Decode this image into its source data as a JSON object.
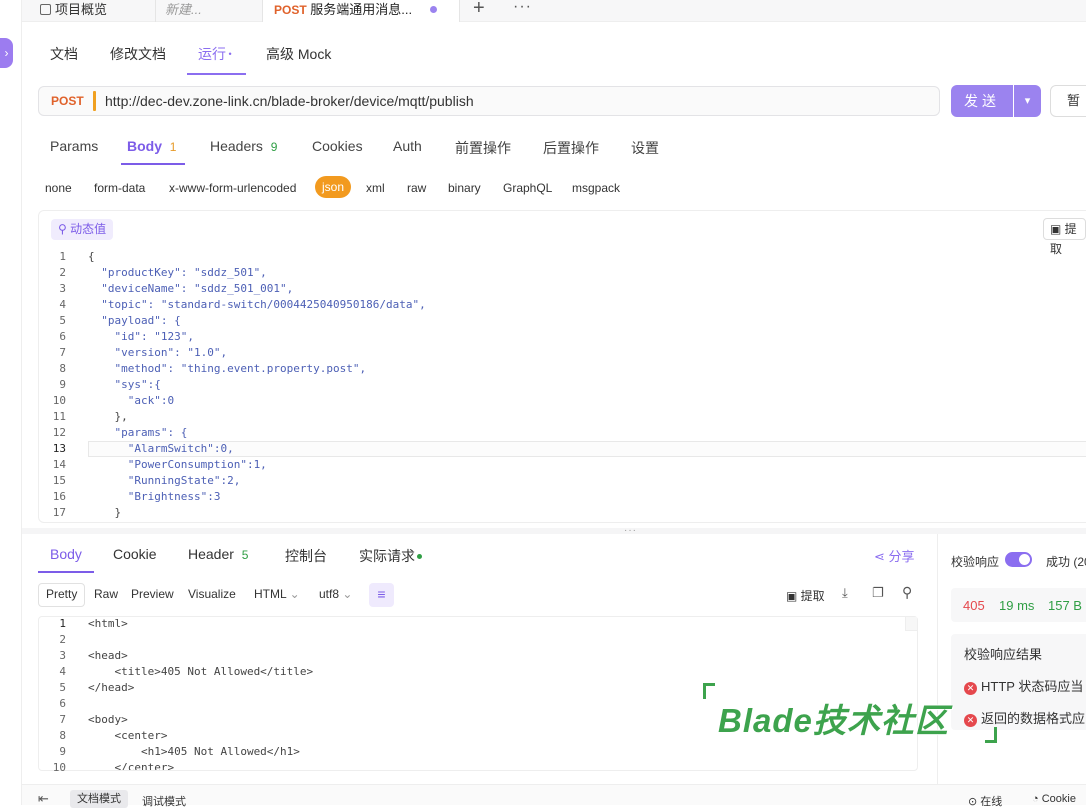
{
  "tabs": [
    {
      "label": "项目概览"
    },
    {
      "label": "新建..."
    },
    {
      "method": "POST",
      "label": "服务端通用消息..."
    }
  ],
  "subnav": {
    "doc": "文档",
    "edit": "修改文档",
    "run": "运行",
    "mock": "高级 Mock"
  },
  "request": {
    "method": "POST",
    "url": "http://dec-dev.zone-link.cn/blade-broker/device/mqtt/publish",
    "send_label": "发送",
    "save_label": "暂"
  },
  "req_tabs": {
    "params": "Params",
    "body": "Body",
    "body_count": "1",
    "headers": "Headers",
    "headers_count": "9",
    "cookies": "Cookies",
    "auth": "Auth",
    "pre": "前置操作",
    "post": "后置操作",
    "settings": "设置"
  },
  "body_types": [
    "none",
    "form-data",
    "x-www-form-urlencoded",
    "json",
    "xml",
    "raw",
    "binary",
    "GraphQL",
    "msgpack"
  ],
  "editor": {
    "dynamic_label": "动态值",
    "extract_label": "提取",
    "line_numbers": [
      "1",
      "2",
      "3",
      "4",
      "5",
      "6",
      "7",
      "8",
      "9",
      "10",
      "11",
      "12",
      "13",
      "14",
      "15",
      "16",
      "17"
    ],
    "lines": [
      "{",
      "  \"productKey\": \"sddz_501\",",
      "  \"deviceName\": \"sddz_501_001\",",
      "  \"topic\": \"standard-switch/0004425040950186/data\",",
      "  \"payload\": {",
      "    \"id\": \"123\",",
      "    \"version\": \"1.0\",",
      "    \"method\": \"thing.event.property.post\",",
      "    \"sys\":{",
      "      \"ack\":0",
      "    },",
      "    \"params\": {",
      "      \"AlarmSwitch\":0,",
      "      \"PowerConsumption\":1,",
      "      \"RunningState\":2,",
      "      \"Brightness\":3",
      "    }"
    ]
  },
  "response_tabs": {
    "body": "Body",
    "cookie": "Cookie",
    "header": "Header",
    "header_count": "5",
    "console": "控制台",
    "actual": "实际请求",
    "share": "分享"
  },
  "view_tabs": {
    "pretty": "Pretty",
    "raw": "Raw",
    "preview": "Preview",
    "visualize": "Visualize",
    "format": "HTML",
    "encoding": "utf8",
    "extract": "提取"
  },
  "response": {
    "line_numbers": [
      "1",
      "2",
      "3",
      "4",
      "5",
      "6",
      "7",
      "8",
      "9",
      "10"
    ],
    "lines": [
      "<html>",
      "",
      "<head>",
      "    <title>405 Not Allowed</title>",
      "</head>",
      "",
      "<body>",
      "    <center>",
      "        <h1>405 Not Allowed</h1>",
      "    </center>"
    ]
  },
  "status": {
    "validate_label": "校验响应",
    "success_label": "成功 (20",
    "code": "405",
    "time": "19 ms",
    "size": "157 B"
  },
  "validation": {
    "title": "校验响应结果",
    "item1": "HTTP 状态码应当",
    "item2": "返回的数据格式应"
  },
  "watermark": "Blade技术社区",
  "footer": {
    "doc_mode": "文档模式",
    "debug_mode": "调试模式",
    "online": "在线",
    "cookie": "Cookie"
  },
  "colors": {
    "accent": "#9b83ef",
    "method": "#e0622b",
    "error": "#e5484d",
    "success": "#2f9e44",
    "watermark": "#3da34d"
  }
}
